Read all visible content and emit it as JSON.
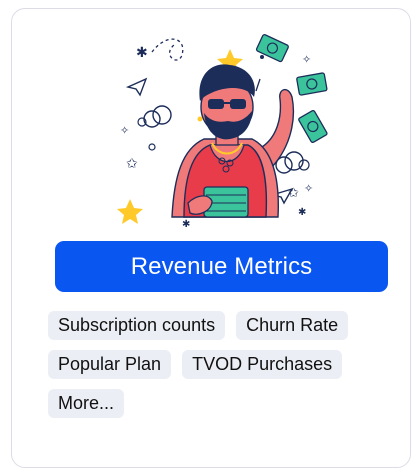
{
  "card": {
    "illustration": {
      "description_icon": "man-with-money-icon",
      "colors": {
        "skin": "#f07a7a",
        "shirt": "#e83c4a",
        "hair": "#1c2d5a",
        "money": "#3bc49b",
        "star": "#ffc92a"
      }
    },
    "cta_label": "Revenue Metrics",
    "cta_color": "#0a56f0",
    "tags": [
      [
        "Subscription counts",
        "Churn Rate"
      ],
      [
        "Popular Plan",
        "TVOD Purchases"
      ],
      [
        "More..."
      ]
    ]
  }
}
